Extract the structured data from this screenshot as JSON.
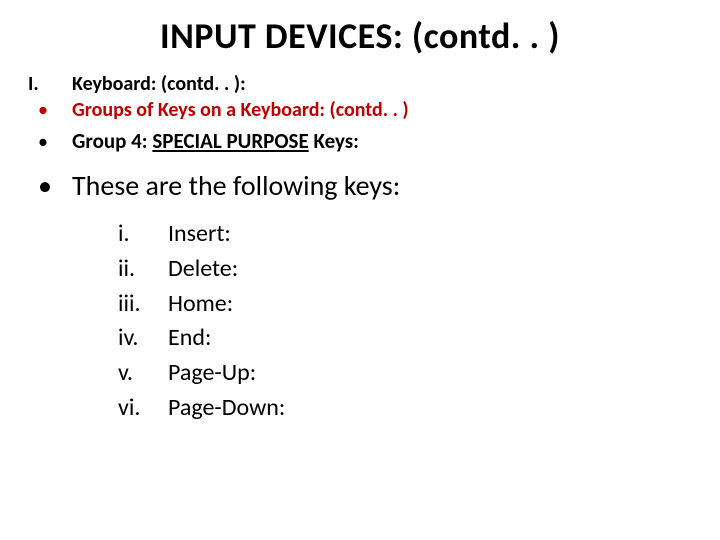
{
  "title": "INPUT DEVICES: (contd. . )",
  "romanMarker": "I.",
  "romanLabel": "Keyboard: (contd. . ):",
  "redBullet": "Groups of Keys on a Keyboard: (contd. . )",
  "group4Prefix": "Group 4:   ",
  "group4Underlined": "SPECIAL PURPOSE",
  "group4Suffix": " Keys:",
  "leadText": "These are the following keys:",
  "bulletGlyph": "•",
  "keys": {
    "i": {
      "marker": "i.",
      "label": "Insert:"
    },
    "ii": {
      "marker": "ii.",
      "label": "Delete:"
    },
    "iii": {
      "marker": "iii.",
      "label": "Home:"
    },
    "iv": {
      "marker": "iv.",
      "label": "End:"
    },
    "v": {
      "marker": "v.",
      "label": "Page-Up:"
    },
    "vi": {
      "marker": "vi.",
      "label": "Page-Down:"
    }
  }
}
